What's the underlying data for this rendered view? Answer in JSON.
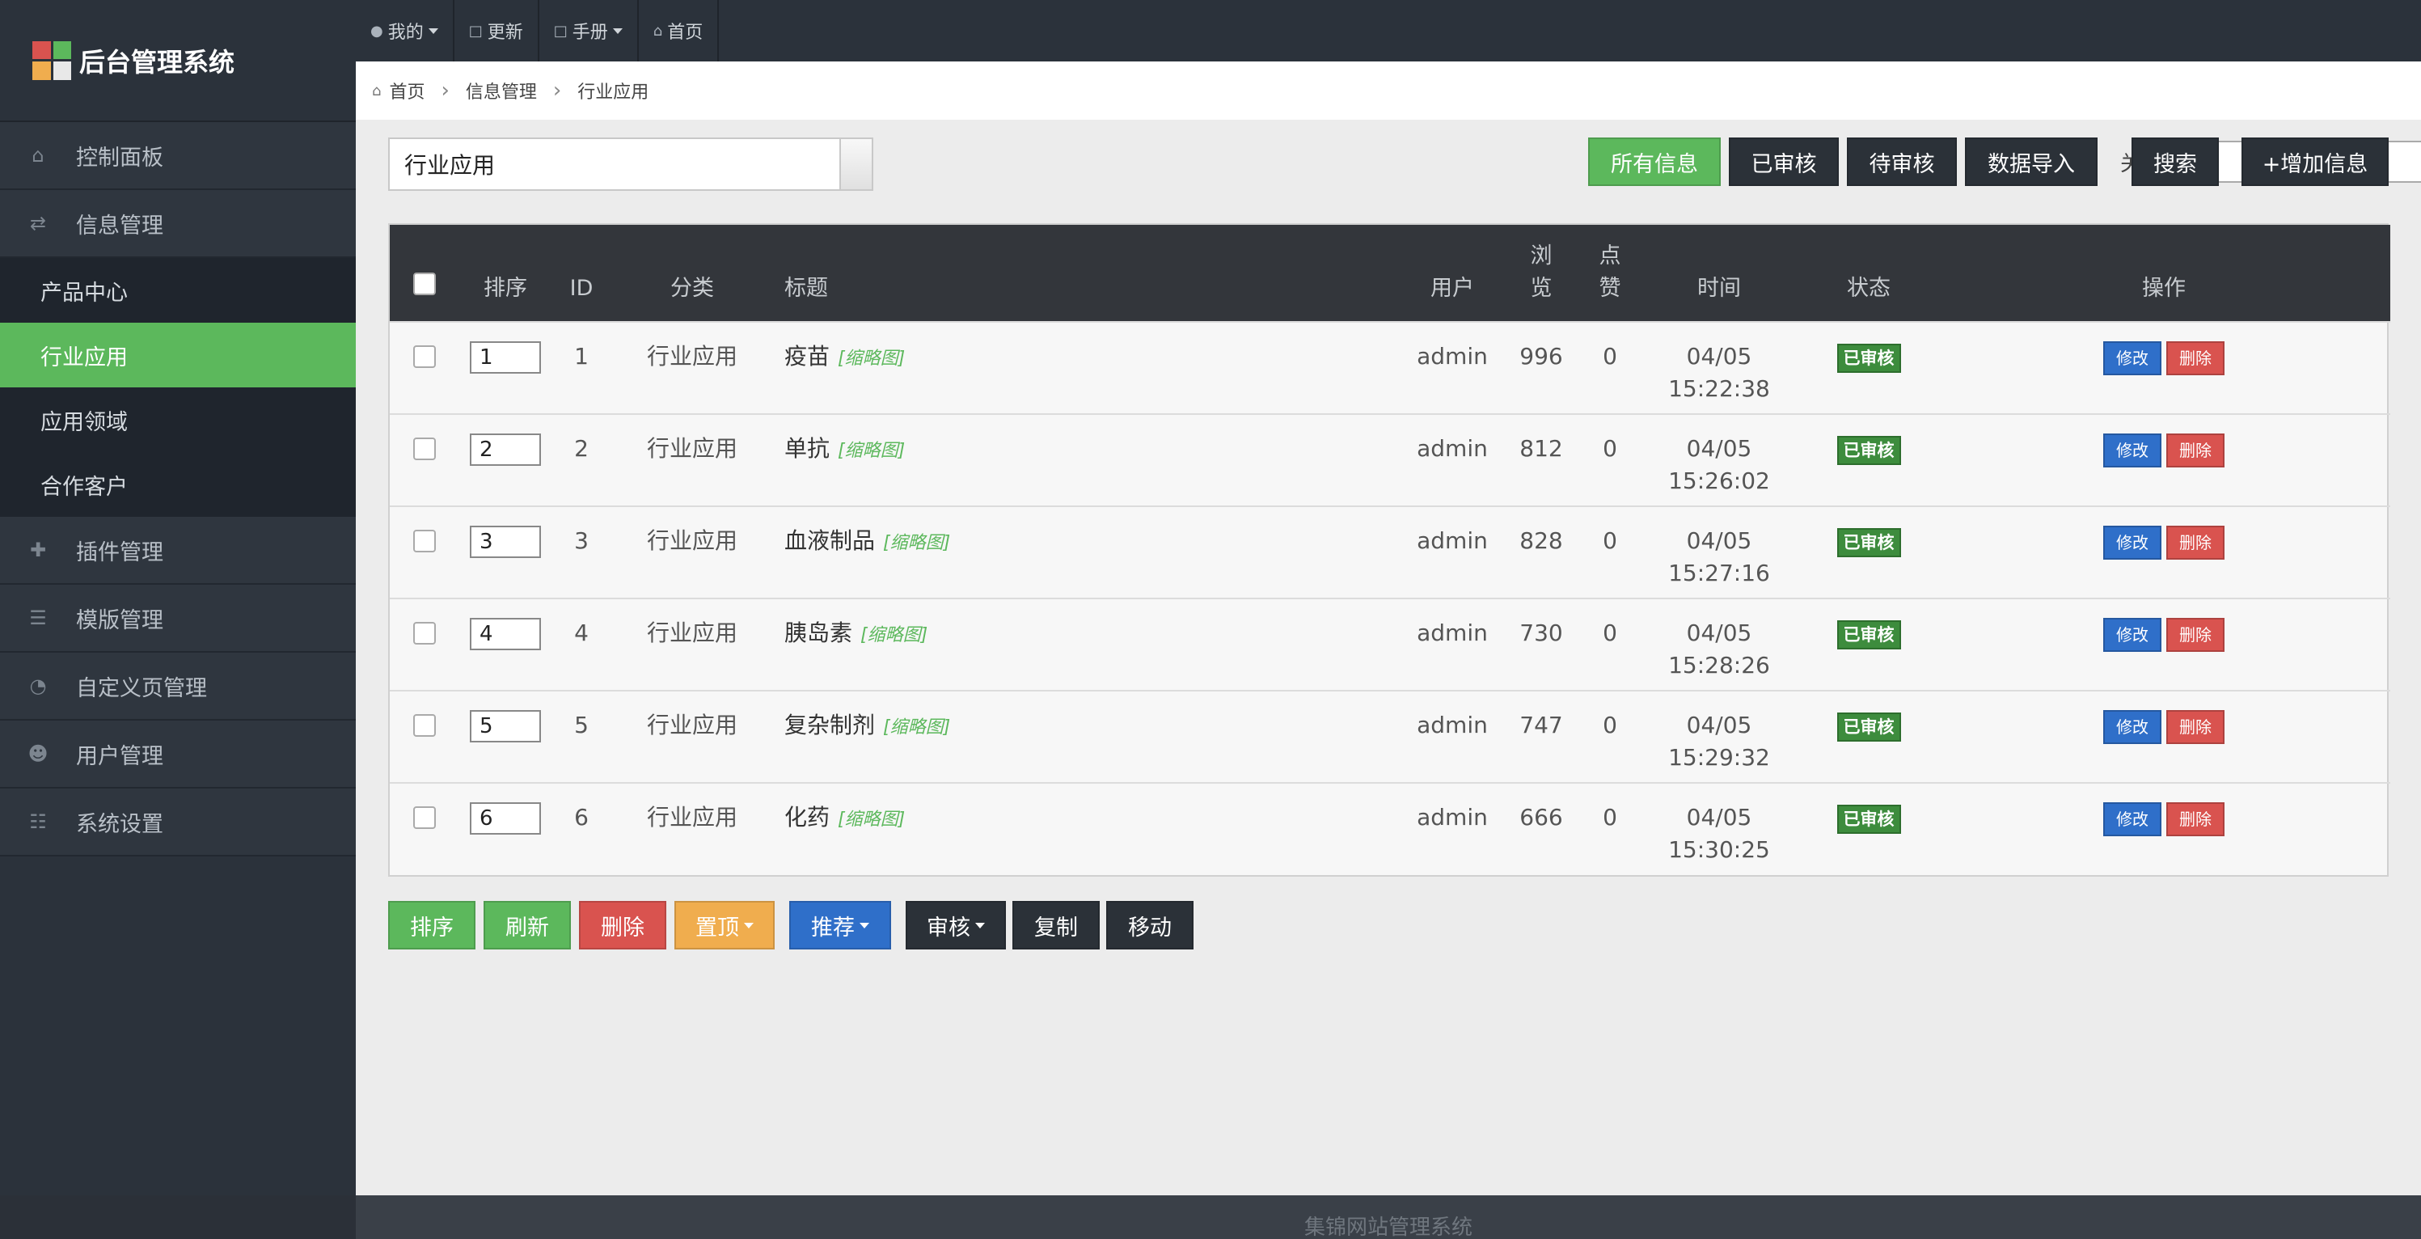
{
  "app": {
    "title": "后台管理系统"
  },
  "topnav": [
    {
      "icon": "user-icon",
      "label": "我的",
      "dropdown": true
    },
    {
      "icon": "file-icon",
      "label": "更新",
      "dropdown": false
    },
    {
      "icon": "file-icon",
      "label": "手册",
      "dropdown": true
    },
    {
      "icon": "home-icon",
      "label": "首页",
      "dropdown": false
    }
  ],
  "sidebar": {
    "items": [
      {
        "icon": "home-icon",
        "label": "控制面板"
      },
      {
        "icon": "refresh-icon",
        "label": "信息管理"
      },
      {
        "label": "产品中心",
        "sub": true
      },
      {
        "label": "行业应用",
        "sub": true,
        "active": true
      },
      {
        "label": "应用领域",
        "sub": true
      },
      {
        "label": "合作客户",
        "sub": true
      },
      {
        "icon": "plus-icon",
        "label": "插件管理"
      },
      {
        "icon": "indent-icon",
        "label": "模版管理"
      },
      {
        "icon": "dashboard-icon",
        "label": "自定义页管理"
      },
      {
        "icon": "users-icon",
        "label": "用户管理"
      },
      {
        "icon": "sitemap-icon",
        "label": "系统设置"
      }
    ]
  },
  "breadcrumb": [
    "首页",
    "信息管理",
    "行业应用"
  ],
  "toolbar": {
    "category_value": "行业应用",
    "all_info": "所有信息",
    "reviewed": "已审核",
    "pending": "待审核",
    "import": "数据导入",
    "keyword_label": "关键词:",
    "keyword_value": "",
    "search": "搜索",
    "add": "+增加信息"
  },
  "table": {
    "headers": {
      "sort": "排序",
      "id": "ID",
      "category": "分类",
      "title": "标题",
      "user": "用户",
      "views": "浏览",
      "likes": "点赞",
      "time": "时间",
      "status": "状态",
      "actions": "操作"
    },
    "thumb_label": "[缩略图]",
    "edit_label": "修改",
    "delete_label": "删除",
    "rows": [
      {
        "sort": "1",
        "id": "1",
        "category": "行业应用",
        "title": "疫苗",
        "user": "admin",
        "views": "996",
        "likes": "0",
        "date": "04/05",
        "time": "15:22:38",
        "status": "已审核"
      },
      {
        "sort": "2",
        "id": "2",
        "category": "行业应用",
        "title": "单抗",
        "user": "admin",
        "views": "812",
        "likes": "0",
        "date": "04/05",
        "time": "15:26:02",
        "status": "已审核"
      },
      {
        "sort": "3",
        "id": "3",
        "category": "行业应用",
        "title": "血液制品",
        "user": "admin",
        "views": "828",
        "likes": "0",
        "date": "04/05",
        "time": "15:27:16",
        "status": "已审核"
      },
      {
        "sort": "4",
        "id": "4",
        "category": "行业应用",
        "title": "胰岛素",
        "user": "admin",
        "views": "730",
        "likes": "0",
        "date": "04/05",
        "time": "15:28:26",
        "status": "已审核"
      },
      {
        "sort": "5",
        "id": "5",
        "category": "行业应用",
        "title": "复杂制剂",
        "user": "admin",
        "views": "747",
        "likes": "0",
        "date": "04/05",
        "time": "15:29:32",
        "status": "已审核"
      },
      {
        "sort": "6",
        "id": "6",
        "category": "行业应用",
        "title": "化药",
        "user": "admin",
        "views": "666",
        "likes": "0",
        "date": "04/05",
        "time": "15:30:25",
        "status": "已审核"
      }
    ]
  },
  "bottom_buttons": {
    "sort": "排序",
    "refresh": "刷新",
    "delete": "删除",
    "top": "置顶",
    "recommend": "推荐",
    "review": "审核",
    "copy": "复制",
    "move": "移动"
  },
  "footer": {
    "text": "集锦网站管理系统"
  },
  "colors": {
    "accent": "#5cb85c",
    "dark": "#2b3138",
    "danger": "#d9534f",
    "primary": "#2f6fc9",
    "warning": "#f0ad4e"
  }
}
